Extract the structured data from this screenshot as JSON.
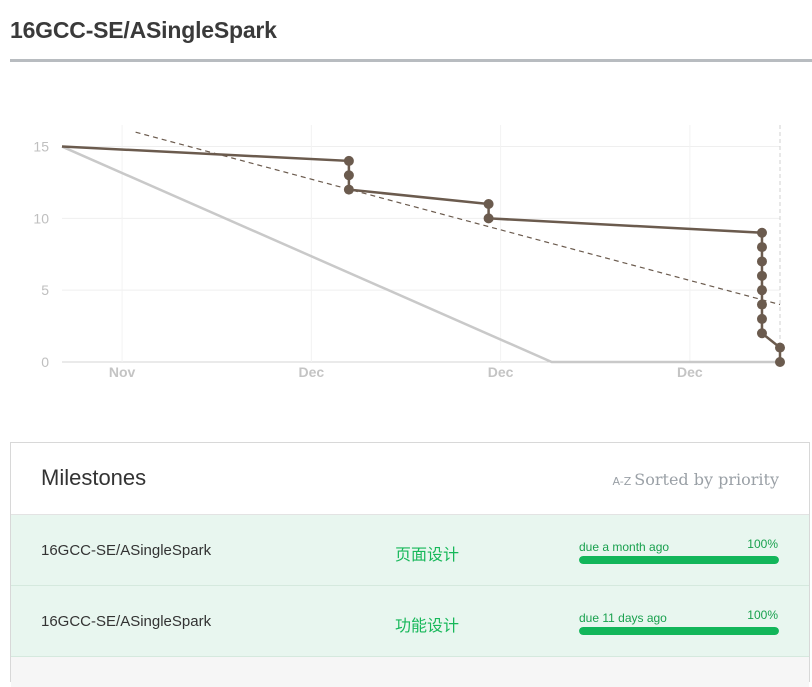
{
  "page": {
    "title": "16GCC-SE/ASingleSpark"
  },
  "chart_data": {
    "type": "line",
    "x_ticks": [
      "Nov",
      "Dec",
      "Dec",
      "Dec",
      "Dec"
    ],
    "y_ticks": [
      "0",
      "5",
      "10",
      "15"
    ],
    "ylim": [
      0,
      15
    ],
    "grid": true,
    "series": [
      {
        "style": "actual",
        "color": "#6b5b4e",
        "points": [
          [
            0,
            15
          ],
          [
            9.55,
            14
          ],
          [
            9.55,
            13
          ],
          [
            9.55,
            12
          ],
          [
            14.2,
            11
          ],
          [
            14.2,
            10
          ],
          [
            23.3,
            9
          ],
          [
            23.3,
            8
          ],
          [
            23.3,
            7
          ],
          [
            23.3,
            6
          ],
          [
            23.3,
            5
          ],
          [
            23.3,
            4
          ],
          [
            23.3,
            3
          ],
          [
            23.3,
            2
          ],
          [
            23.9,
            1
          ],
          [
            23.9,
            0
          ]
        ]
      },
      {
        "style": "ideal",
        "color": "#c9c9c9",
        "points": [
          [
            0,
            15
          ],
          [
            16.3,
            0
          ],
          [
            23.9,
            0
          ]
        ]
      },
      {
        "style": "trend",
        "color": "#6b5b4e",
        "points": [
          [
            2.45,
            16
          ],
          [
            23.9,
            4
          ]
        ]
      }
    ]
  },
  "milestones": {
    "title": "Milestones",
    "sort_badge": "A-Z",
    "sort_label": "Sorted by priority",
    "items": [
      {
        "name": "16GCC-SE/ASingleSpark",
        "category": "页面设计",
        "due": "due a month ago",
        "percent_label": "100%",
        "percent": 1.0
      },
      {
        "name": "16GCC-SE/ASingleSpark",
        "category": "功能设计",
        "due": "due 11 days ago",
        "percent_label": "100%",
        "percent": 1.0
      }
    ]
  }
}
